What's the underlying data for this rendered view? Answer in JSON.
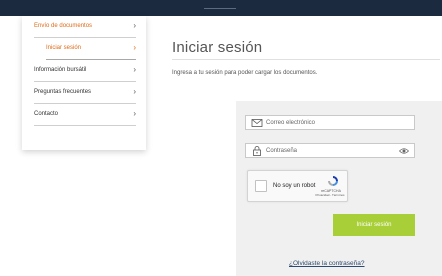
{
  "sidebar": {
    "items": [
      {
        "label": "Envío de documentos",
        "chevron": "›"
      },
      {
        "label": "Iniciar sesión",
        "chevron": "›"
      },
      {
        "label": "Información bursátil",
        "chevron": "›"
      },
      {
        "label": "Preguntas frecuentes",
        "chevron": "›"
      },
      {
        "label": "Contacto",
        "chevron": "›"
      }
    ]
  },
  "main": {
    "title": "Iniciar sesión",
    "subtitle": "Ingresa a tu sesión para poder cargar los documentos."
  },
  "form": {
    "email_placeholder": "Correo electrónico",
    "password_placeholder": "Contraseña",
    "captcha_label": "No soy un robot",
    "captcha_brand": "reCAPTCHA",
    "captcha_links": "Privacidad - Términos",
    "submit_label": "Iniciar sesión",
    "forgot_link": "¿Olvidaste la contraseña?"
  },
  "colors": {
    "topbar": "#1b2a3f",
    "accent_orange": "#e06a17",
    "button_green": "#a9cf38",
    "link_blue": "#2d4a6e"
  }
}
